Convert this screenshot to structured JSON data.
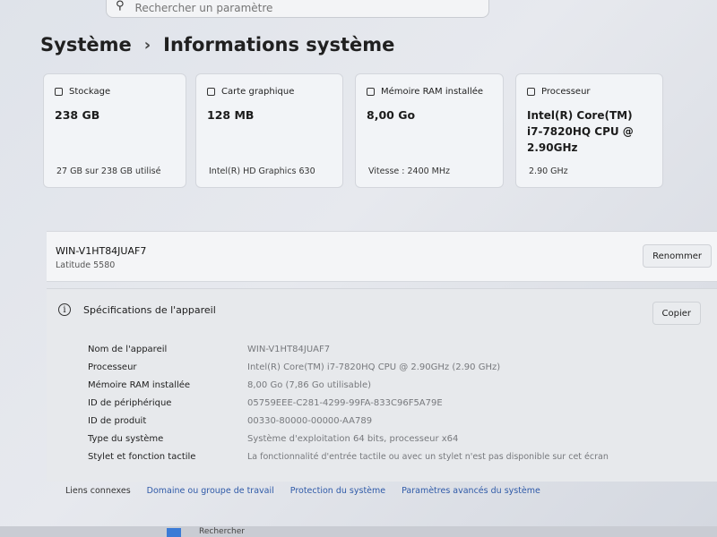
{
  "search": {
    "placeholder": "Rechercher un paramètre"
  },
  "breadcrumb": {
    "parent": "Système",
    "separator": "›",
    "current": "Informations système"
  },
  "cards": [
    {
      "icon": "storage-icon",
      "title": "Stockage",
      "value": "238 GB",
      "footer": "27 GB sur 238 GB utilisé"
    },
    {
      "icon": "gpu-icon",
      "title": "Carte graphique",
      "value": "128 MB",
      "footer": "Intel(R) HD Graphics 630"
    },
    {
      "icon": "ram-icon",
      "title": "Mémoire RAM installée",
      "value": "8,00 Go",
      "footer": "Vitesse : 2400 MHz"
    },
    {
      "icon": "processor-icon",
      "title": "Processeur",
      "value": "Intel(R) Core(TM) i7-7820HQ CPU @ 2.90GHz",
      "footer": "2.90 GHz"
    }
  ],
  "device": {
    "name": "WIN-V1HT84JUAF7",
    "model": "Latitude 5580",
    "rename_label": "Renommer"
  },
  "specs": {
    "heading": "Spécifications de l'appareil",
    "copy_label": "Copier",
    "rows": [
      {
        "key": "Nom de l'appareil",
        "value": "WIN-V1HT84JUAF7"
      },
      {
        "key": "Processeur",
        "value": "Intel(R) Core(TM) i7-7820HQ CPU @ 2.90GHz (2.90 GHz)"
      },
      {
        "key": "Mémoire RAM installée",
        "value": "8,00 Go (7,86 Go utilisable)"
      },
      {
        "key": "ID de périphérique",
        "value": "05759EEE-C281-4299-99FA-833C96F5A79E"
      },
      {
        "key": "ID de produit",
        "value": "00330-80000-00000-AA789"
      },
      {
        "key": "Type du système",
        "value": "Système d'exploitation 64 bits, processeur x64"
      },
      {
        "key": "Stylet et fonction tactile",
        "value": "La fonctionnalité d'entrée tactile ou avec un stylet n'est pas disponible sur cet écran"
      }
    ]
  },
  "links": {
    "label": "Liens connexes",
    "items": [
      "Domaine ou groupe de travail",
      "Protection du système",
      "Paramètres avancés du système"
    ]
  },
  "taskbar": {
    "search_label": "Rechercher"
  }
}
